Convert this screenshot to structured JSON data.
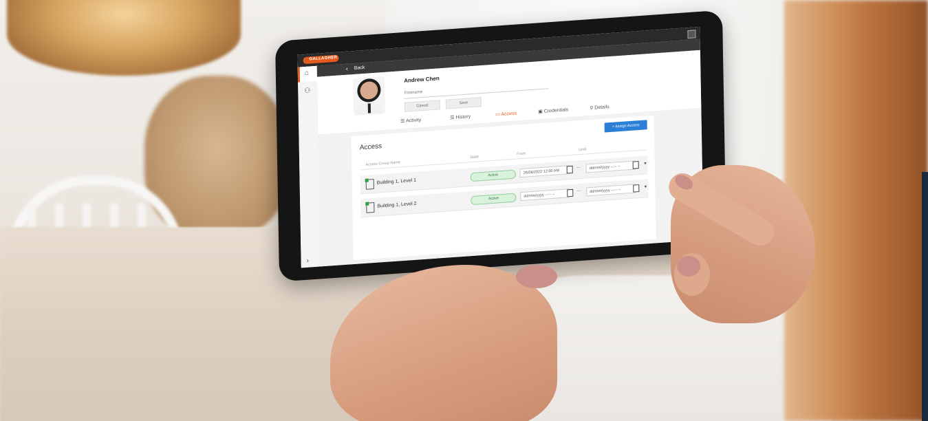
{
  "app": {
    "logo_text": "GALLAGHER",
    "back_label": "Back"
  },
  "profile": {
    "name": "Andrew Chen",
    "field_label": "Firstname",
    "buttons": [
      "Cancel",
      "Save"
    ]
  },
  "tabs": [
    {
      "label": "Activity",
      "icon": "list-icon"
    },
    {
      "label": "History",
      "icon": "list-icon"
    },
    {
      "label": "Access",
      "icon": "document-icon",
      "active": true
    },
    {
      "label": "Credentials",
      "icon": "badge-icon"
    },
    {
      "label": "Details",
      "icon": "person-icon"
    }
  ],
  "access": {
    "title": "Access",
    "assign_button": "+ Assign Access",
    "columns": [
      "Access Group Name",
      "State",
      "From",
      "Until"
    ],
    "rows": [
      {
        "name": "Building 1, Level 1",
        "state": "Active",
        "from": "26/08/2022 12:00 AM",
        "until": "dd/mm/yyyy --:-- --"
      },
      {
        "name": "Building 1, Level 2",
        "state": "Active",
        "from": "dd/mm/yyyy --:-- --",
        "until": "dd/mm/yyyy --:-- --"
      }
    ]
  },
  "colors": {
    "brand_orange": "#e35a1c",
    "assign_blue": "#2b7fd6",
    "active_green": "#2e7d3a"
  }
}
